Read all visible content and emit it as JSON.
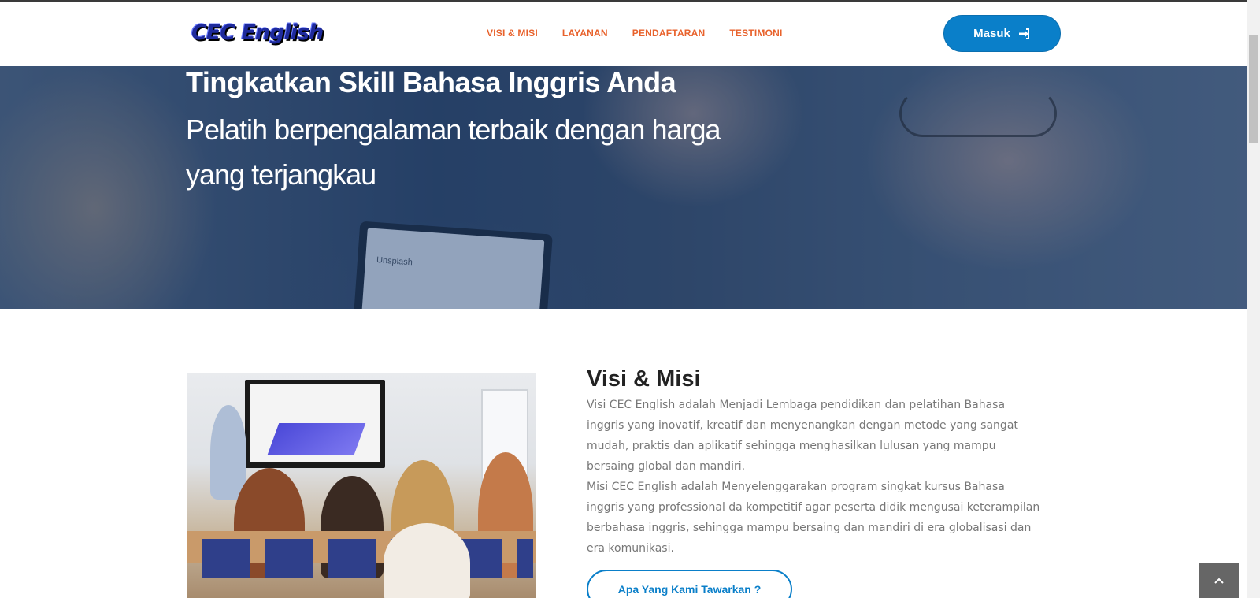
{
  "header": {
    "logo_text": "CEC English",
    "nav": [
      {
        "label": "VISI & MISI"
      },
      {
        "label": "LAYANAN"
      },
      {
        "label": "PENDAFTARAN"
      },
      {
        "label": "TESTIMONI"
      }
    ],
    "login_label": "Masuk",
    "login_icon": "sign-in-icon"
  },
  "hero": {
    "title": "Tingkatkan Skill Bahasa Inggris Anda",
    "subtitle": "Pelatih berpengalaman terbaik dengan harga yang terjangkau",
    "laptop_text": "Unsplash"
  },
  "about": {
    "title": "Visi & Misi",
    "visi": "Visi CEC English adalah Menjadi Lembaga pendidikan dan pelatihan Bahasa inggris yang inovatif, kreatif dan menyenangkan dengan metode yang sangat mudah, praktis dan aplikatif sehingga menghasilkan lulusan yang mampu bersaing global dan mandiri.",
    "misi": "Misi CEC English adalah Menyelenggarakan program singkat kursus Bahasa inggris yang professional da kompetitif agar peserta didik mengusai keterampilan berbahasa inggris, sehingga mampu bersaing dan mandiri di era globalisasi dan era komunikasi.",
    "offer_button": "Apa Yang Kami Tawarkan ?"
  },
  "colors": {
    "nav": "#e8622c",
    "accent": "#0a7fc9",
    "heading": "#222222",
    "body_text": "#777777"
  },
  "icons": {
    "back_to_top": "chevron-up-icon"
  }
}
